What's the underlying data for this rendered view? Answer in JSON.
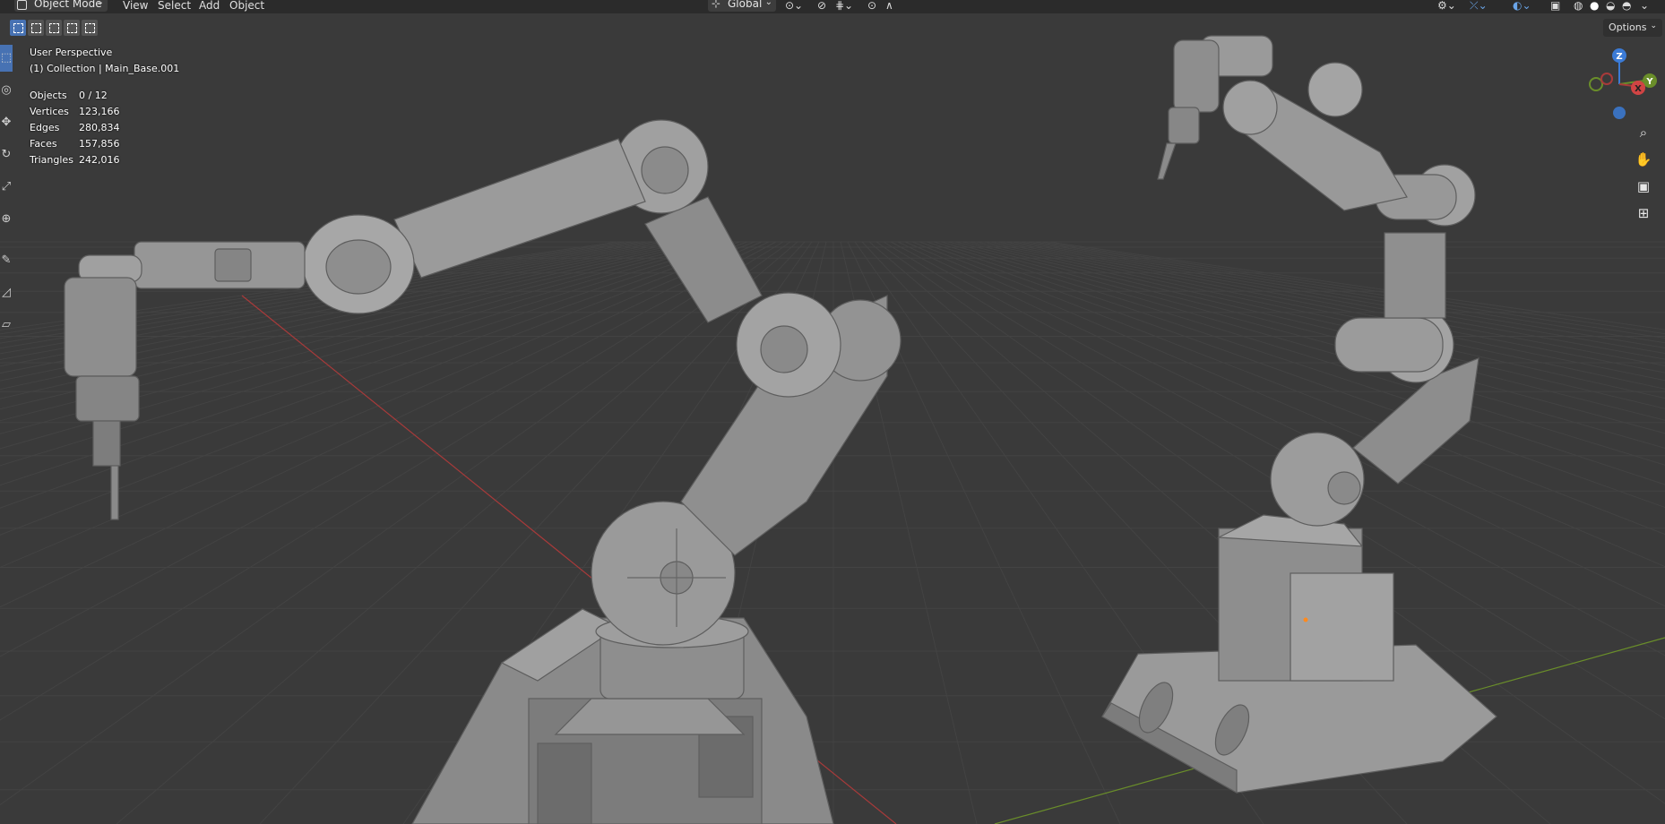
{
  "header": {
    "mode": "Object Mode",
    "menus": [
      "View",
      "Select",
      "Add",
      "Object"
    ],
    "transform_orientation": "Global"
  },
  "options_label": "Options",
  "overlay": {
    "view_name": "User Perspective",
    "collection": "(1) Collection | Main_Base.001"
  },
  "stats": [
    {
      "label": "Objects",
      "value": "0 / 12"
    },
    {
      "label": "Vertices",
      "value": "123,166"
    },
    {
      "label": "Edges",
      "value": "280,834"
    },
    {
      "label": "Faces",
      "value": "157,856"
    },
    {
      "label": "Triangles",
      "value": "242,016"
    }
  ],
  "gizmo": {
    "z": "Z",
    "y": "Y",
    "x": "X"
  },
  "colors": {
    "background": "#393939",
    "x_axis": "#a83a3a",
    "y_axis": "#6a8e2a",
    "z_axis": "#3b7bd6",
    "active_tool": "#4772b3",
    "model_gray": "#8c8c8c"
  },
  "icons": {
    "zoom": "magnifier-plus-icon",
    "pan": "hand-icon",
    "camera": "camera-icon",
    "ortho": "grid-icon"
  }
}
